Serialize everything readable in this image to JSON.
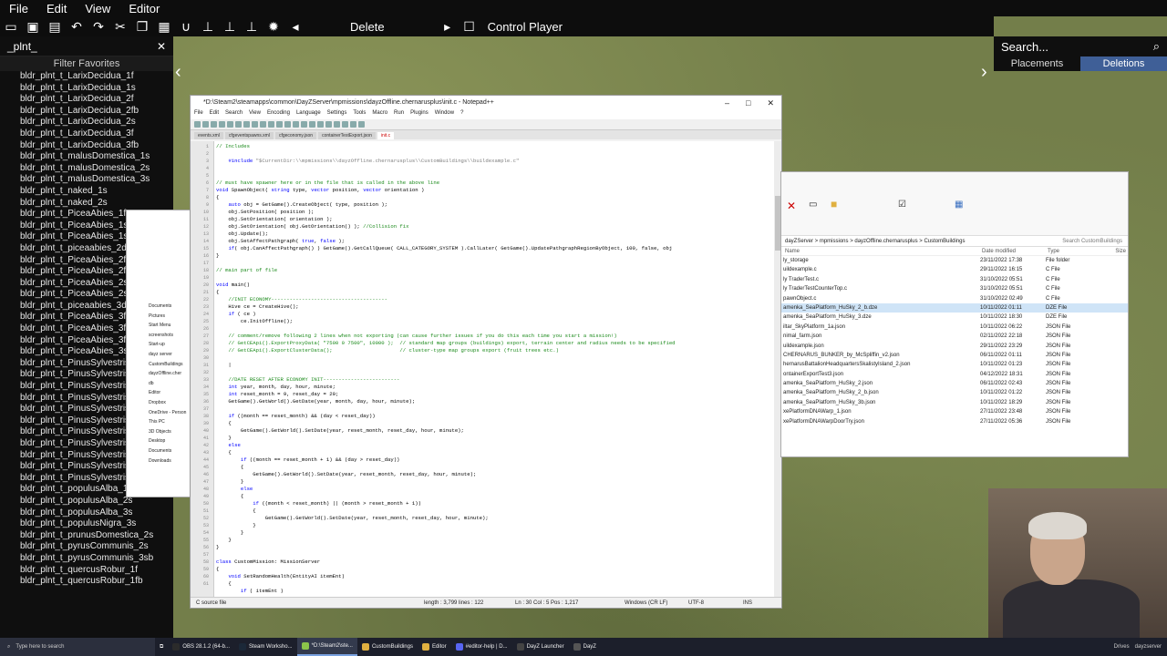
{
  "menu": {
    "items": [
      "File",
      "Edit",
      "View",
      "Editor"
    ]
  },
  "toolbar": {
    "delete_label": "Delete",
    "control_player_label": "Control Player"
  },
  "left_panel": {
    "search": "_plnt_",
    "filter_label": "Filter Favorites",
    "items": [
      "bldr_plnt_t_LarixDecidua_1f",
      "bldr_plnt_t_LarixDecidua_1s",
      "bldr_plnt_t_LarixDecidua_2f",
      "bldr_plnt_t_LarixDecidua_2fb",
      "bldr_plnt_t_LarixDecidua_2s",
      "bldr_plnt_t_LarixDecidua_3f",
      "bldr_plnt_t_LarixDecidua_3fb",
      "bldr_plnt_t_malusDomestica_1s",
      "bldr_plnt_t_malusDomestica_2s",
      "bldr_plnt_t_malusDomestica_3s",
      "bldr_plnt_t_naked_1s",
      "bldr_plnt_t_naked_2s",
      "bldr_plnt_t_PiceaAbies_1f",
      "bldr_plnt_t_PiceaAbies_1s",
      "bldr_plnt_t_PiceaAbies_1sb",
      "bldr_plnt_t_piceaabies_2d",
      "bldr_plnt_t_PiceaAbies_2f",
      "bldr_plnt_t_PiceaAbies_2fb",
      "bldr_plnt_t_PiceaAbies_2s",
      "bldr_plnt_t_PiceaAbies_2sb",
      "bldr_plnt_t_piceaabies_3d",
      "bldr_plnt_t_PiceaAbies_3f",
      "bldr_plnt_t_PiceaAbies_3fb",
      "bldr_plnt_t_PiceaAbies_3fc",
      "bldr_plnt_t_PiceaAbies_3s",
      "bldr_plnt_t_PinusSylvestris",
      "bldr_plnt_t_PinusSylvestris",
      "bldr_plnt_t_PinusSylvestris",
      "bldr_plnt_t_PinusSylvestris",
      "bldr_plnt_t_PinusSylvestris",
      "bldr_plnt_t_PinusSylvestris",
      "bldr_plnt_t_PinusSylvestris",
      "bldr_plnt_t_PinusSylvestris",
      "bldr_plnt_t_PinusSylvestris",
      "bldr_plnt_t_PinusSylvestris_3fc",
      "bldr_plnt_t_PinusSylvestris_3s",
      "bldr_plnt_t_populusAlba_1f",
      "bldr_plnt_t_populusAlba_2s",
      "bldr_plnt_t_populusAlba_3s",
      "bldr_plnt_t_populusNigra_3s",
      "bldr_plnt_t_prunusDomestica_2s",
      "bldr_plnt_t_pyrusCommunis_2s",
      "bldr_plnt_t_pyrusCommunis_3sb",
      "bldr_plnt_t_quercusRobur_1f",
      "bldr_plnt_t_quercusRobur_1fb"
    ]
  },
  "right_panel": {
    "search": "Search...",
    "tabs": [
      "Placements",
      "Deletions"
    ]
  },
  "notepad": {
    "title": "*D:\\Steam2\\steamapps\\common\\DayZServer\\mpmissions\\dayzOffline.chernarusplus\\init.c - Notepad++",
    "menu": [
      "File",
      "Edit",
      "Search",
      "View",
      "Encoding",
      "Language",
      "Settings",
      "Tools",
      "Macro",
      "Run",
      "Plugins",
      "Window",
      "?"
    ],
    "tabs": [
      "events.xml",
      "cfgeventspawns.xml",
      "cfgeconomy.json",
      "containerTestExport.json",
      "init.c"
    ],
    "status": {
      "type": "C source file",
      "length": "length : 3,799   lines : 122",
      "pos": "Ln : 30   Col : 5   Pos : 1,217",
      "eol": "Windows (CR LF)",
      "enc": "UTF-8",
      "ins": "INS"
    }
  },
  "explorer": {
    "address": "dayZServer  >  mpmissions  >  dayzOffline.chernarusplus  >  CustomBuildings",
    "search_placeholder": "Search CustomBuildings",
    "headers": [
      "Name",
      "Date modified",
      "Type",
      "Size"
    ],
    "rows": [
      [
        "ly_storage",
        "23/11/2022 17:38",
        "File folder",
        ""
      ],
      [
        "uildexample.c",
        "29/11/2022 16:15",
        "C File",
        ""
      ],
      [
        "ly TraderTest.c",
        "31/10/2022 05:51",
        "C File",
        ""
      ],
      [
        "ly TraderTestCounterTop.c",
        "31/10/2022 05:51",
        "C File",
        ""
      ],
      [
        "pawnObject.c",
        "31/10/2022 02:49",
        "C File",
        ""
      ],
      [
        "amenka_SeaPlatform_HuSky_2_b.dze",
        "10/11/2022 01:11",
        "DZE File",
        ""
      ],
      [
        "amenka_SeaPlatform_HuSky_3.dze",
        "10/11/2022 18:30",
        "DZE File",
        ""
      ],
      [
        "iltar_SkyPlatform_1a.json",
        "10/11/2022 06:22",
        "JSON File",
        ""
      ],
      [
        "nimal_farm.json",
        "02/11/2022 22:18",
        "JSON File",
        ""
      ],
      [
        "uildexample.json",
        "29/11/2022 23:29",
        "JSON File",
        ""
      ],
      [
        "CHERNARUS_BUNKER_by_McSpliffin_v2.json",
        "06/11/2022 01:11",
        "JSON File",
        ""
      ],
      [
        "hernarusBattalionHeadquartersSkalistyIsland_2.json",
        "10/11/2022 01:23",
        "JSON File",
        ""
      ],
      [
        "ontainerExportTest3.json",
        "04/12/2022 18:31",
        "JSON File",
        ""
      ],
      [
        "amenka_SeaPlatform_HuSky_2.json",
        "06/11/2022 02:43",
        "JSON File",
        ""
      ],
      [
        "amenka_SeaPlatform_HuSky_2_b.json",
        "10/11/2022 01:22",
        "JSON File",
        ""
      ],
      [
        "amenka_SeaPlatform_HuSky_3b.json",
        "10/11/2022 18:29",
        "JSON File",
        ""
      ],
      [
        "xePlatformDNAWarp_1.json",
        "27/11/2022 23:48",
        "JSON File",
        ""
      ],
      [
        "xePlatformDNAWarpDoorTry.json",
        "27/11/2022 05:36",
        "JSON File",
        ""
      ]
    ]
  },
  "small_explorer": {
    "items": [
      "Documents",
      "Pictures",
      "Start Menu",
      "screenshots",
      "Start-up",
      "dayz server",
      "CustomBuildings",
      "dayzOffline.cher",
      "db",
      "Editor",
      "Dropbox",
      "OneDrive - Person",
      "This PC",
      "3D Objects",
      "Desktop",
      "Documents",
      "Downloads"
    ]
  },
  "taskbar": {
    "search_placeholder": "Type here to search",
    "items": [
      "OBS 28.1.2 (64-b...",
      "Steam Worksho...",
      "*D:\\Steam2\\ste...",
      "CustomBuildings",
      "Editor",
      "#editor-help | D...",
      "DayZ Launcher",
      "DayZ"
    ],
    "tray": [
      "Drives",
      "dayzserver"
    ]
  },
  "colors": {
    "accent": "#3f5f97",
    "panel": "#0f0f0f"
  }
}
